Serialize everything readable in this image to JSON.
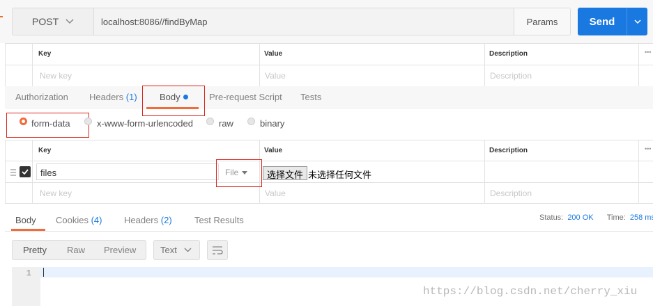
{
  "request": {
    "method": "POST",
    "url": "localhost:8086//findByMap",
    "params_label": "Params",
    "send_label": "Send"
  },
  "params_table": {
    "headers": [
      "Key",
      "Value",
      "Description"
    ],
    "placeholder": {
      "key": "New key",
      "value": "Value",
      "description": "Description"
    },
    "more": "•••"
  },
  "request_tabs": [
    {
      "label": "Authorization"
    },
    {
      "label": "Headers",
      "count": "(1)"
    },
    {
      "label": "Body"
    },
    {
      "label": "Pre-request Script"
    },
    {
      "label": "Tests"
    }
  ],
  "body_modes": [
    "form-data",
    "x-www-form-urlencoded",
    "raw",
    "binary"
  ],
  "body_modes_selected": "form-data",
  "form_table": {
    "headers": [
      "Key",
      "Value",
      "Description"
    ],
    "row": {
      "key": "files",
      "type": "File",
      "choose_button": "选择文件",
      "no_file": "未选择任何文件"
    },
    "placeholder": {
      "key": "New key",
      "value": "Value",
      "description": "Description"
    },
    "more": "•••"
  },
  "response_tabs": [
    {
      "label": "Body"
    },
    {
      "label": "Cookies",
      "count": "(4)"
    },
    {
      "label": "Headers",
      "count": "(2)"
    },
    {
      "label": "Test Results"
    }
  ],
  "response_status": {
    "status_label": "Status:",
    "status_value": "200 OK",
    "time_label": "Time:",
    "time_value": "258 ms"
  },
  "view_modes": [
    "Pretty",
    "Raw",
    "Preview"
  ],
  "format": "Text",
  "editor": {
    "line_number": "1"
  },
  "watermark": "https://blog.csdn.net/cherry_xiu",
  "colors": {
    "accent": "#1a79e0",
    "tab_underline": "#f26b3a",
    "highlight_box": "#d9261c"
  }
}
